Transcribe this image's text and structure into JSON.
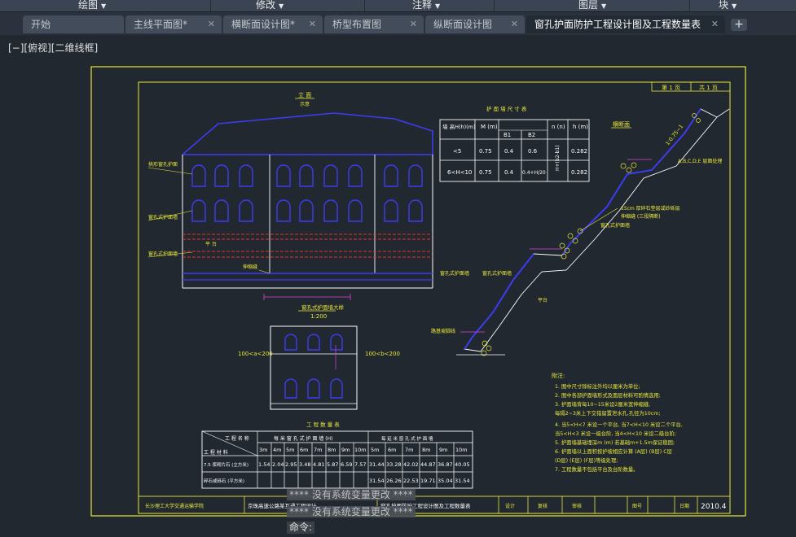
{
  "menubar": {
    "items": [
      {
        "label": "绘图"
      },
      {
        "label": "修改"
      },
      {
        "label": "注释"
      },
      {
        "label": "图层"
      },
      {
        "label": "块"
      }
    ]
  },
  "tabs": [
    {
      "label": "开始",
      "closable": false
    },
    {
      "label": "主线平面图*",
      "closable": true
    },
    {
      "label": "横断面设计图*",
      "closable": true
    },
    {
      "label": "桥型布置图",
      "closable": true
    },
    {
      "label": "纵断面设计图",
      "closable": true
    },
    {
      "label": "窗孔护面防护工程设计图及工程数量表",
      "closable": true,
      "active": true
    }
  ],
  "viewport": {
    "label": "[−][俯视][二维线框]"
  },
  "drawing": {
    "sheet": {
      "left": "第 1 页",
      "right": "共 1 页"
    },
    "front_view": {
      "title": "立 面",
      "scale": "示意"
    },
    "front_labels": [
      "拱形窗孔护面",
      "窗孔式护面墙",
      "窗孔式护面墙",
      "平 台",
      "伸缩缝"
    ],
    "detail": {
      "title": "窗孔式护面墙大样",
      "scale": "1:200",
      "left_dim": "100<a<200",
      "right_dim": "100<b<200"
    },
    "dim_table": {
      "title": "护 面 墙 尺 寸 表",
      "headers": [
        "墙 高H(h)(m)",
        "M (m)",
        "B1",
        "B2",
        "n (n)",
        "h (m)"
      ],
      "rows": [
        [
          "<5",
          "0.75",
          "0.4",
          "0.6",
          "H+(b2-b1)",
          "0.282"
        ],
        [
          "6<H<10",
          "0.75",
          "0.4",
          "0.4+H/20",
          "H+(b2-b1)",
          "0.282"
        ]
      ]
    },
    "section": {
      "title": "横断面",
      "labels": [
        "1:0.75~1",
        "A,B,C,D,E 层面处理",
        "15cm 厚碎石垫层或砂砾层",
        "窗孔式护面墙",
        "伸缩缝 (三段隔断)",
        "窗孔式护面墙",
        "窗孔式护面墙",
        "平台",
        "路基坡脚线"
      ]
    },
    "qty_table": {
      "title": "工 程 数 量 表",
      "group1": "每 米 窗 孔 式 护 面 墙 (H)",
      "group2": "每 延 米 窗 孔 式 护 面 墙",
      "row_header_top": "工 程 名 称",
      "row_header_bottom": "工 程 材 料",
      "heights": [
        "3m",
        "4m",
        "5m",
        "6m",
        "7m",
        "8m",
        "9m",
        "10m",
        "5m",
        "6m",
        "7m",
        "8m",
        "9m",
        "10m"
      ],
      "rows": [
        {
          "name": "7.5 浆砌片石 (立方米)",
          "values": [
            "1.54",
            "2.04",
            "2.95",
            "3.48",
            "4.81",
            "5.87",
            "6.59",
            "7.57",
            "31.44",
            "33.28",
            "42.02",
            "44.87",
            "36.87",
            "40.05"
          ]
        },
        {
          "name": "碎石或砾石 (平方米)",
          "values": [
            "",
            "",
            "",
            "",
            "",
            "",
            "",
            "",
            "31.54",
            "26.26",
            "22.53",
            "19.71",
            "35.04",
            "31.54"
          ]
        }
      ]
    },
    "notes": {
      "title": "附注:",
      "items": [
        "1. 图中尺寸除标注外均以厘米为单位;",
        "2. 图中各部护面墙形式及面层材料可酌情选用;",
        "3. 护面墙背每10~15米设2厘米宽伸缩缝,",
        "   每隔2~3米上下交错留置泄水孔,孔径为10cm;",
        "4. 当5<H<7 米设一个平台, 当7<H<10 米设二个平台,",
        "   当5<H<3 米设一级台阶, 当4<H<10 米设二级台阶;",
        "5. 护面墙基础埋深m (m) 若基础m+1.5m保证稳固;",
        "6. 护面墙以上面积按护坡相应计算 (A层) (B层) C层",
        "   (D层) (E层) (F层)等级处理;",
        "7. 工程数量不包括平台及台阶数量。"
      ]
    },
    "title_block": {
      "org": "长沙理工大学交通运输学院",
      "project": "京珠高速公路某互通工程设计",
      "drawing": "窗孔护面防护工程设计图及工程数量表",
      "designer": "设计",
      "checker": "复核",
      "reviewer": "审核",
      "sheet_no": "图号",
      "date_label": "日期",
      "date": "2010.4"
    }
  },
  "command": {
    "msg1": "****  没有系统变量更改  ****",
    "msg2": "****  没有系统变量更改  ****",
    "prompt": "命令:"
  }
}
